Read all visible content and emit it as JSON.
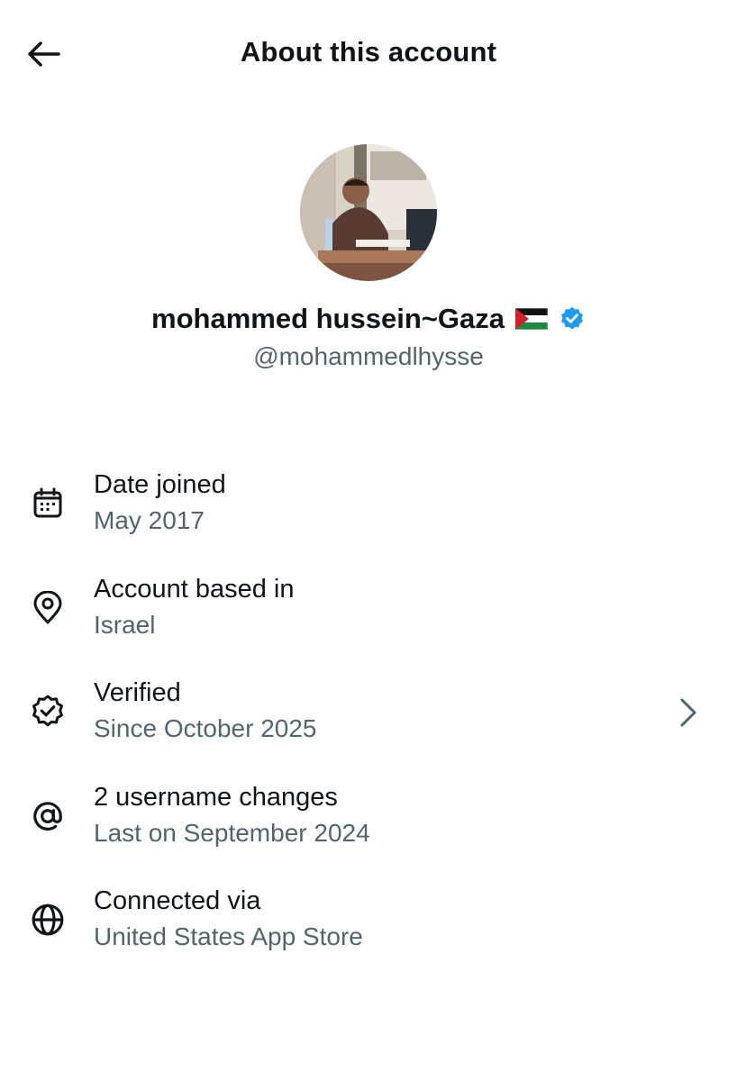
{
  "header": {
    "title": "About this account",
    "back_icon": "arrow-left-icon"
  },
  "profile": {
    "display_name": "mohammed hussein~Gaza",
    "flag_icon": "palestine-flag-icon",
    "verified_icon": "verified-badge-icon",
    "handle": "@mohammedlhysse",
    "verified_color": "#1d9bf0"
  },
  "rows": [
    {
      "icon": "calendar-icon",
      "title": "Date joined",
      "subtitle": "May 2017"
    },
    {
      "icon": "location-pin-icon",
      "title": "Account based in",
      "subtitle": "Israel"
    },
    {
      "icon": "verified-check-icon",
      "title": "Verified",
      "subtitle": "Since October 2025"
    },
    {
      "icon": "at-sign-icon",
      "title": "2 username changes",
      "subtitle": "Last on September 2024"
    },
    {
      "icon": "globe-icon",
      "title": "Connected via",
      "subtitle": "United States App Store"
    }
  ],
  "colors": {
    "text_primary": "#0f1419",
    "text_secondary": "#536471",
    "accent": "#1d9bf0"
  }
}
